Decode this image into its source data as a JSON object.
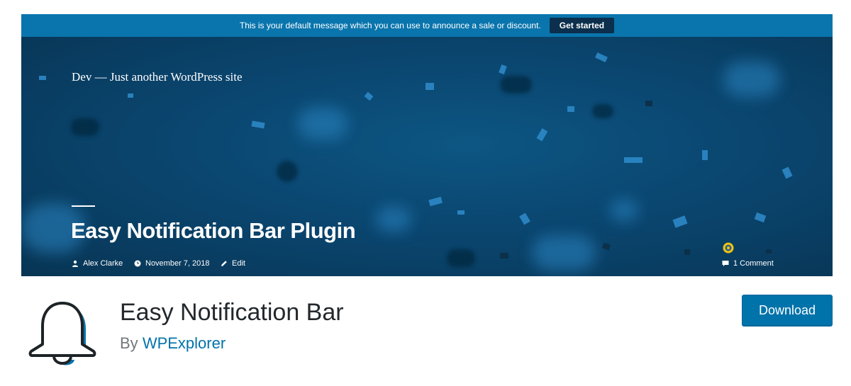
{
  "notification_bar": {
    "message": "This is your default message which you can use to announce a sale or discount.",
    "button_label": "Get started"
  },
  "hero": {
    "site_title": "Dev — Just another WordPress site",
    "post_title": "Easy Notification Bar Plugin",
    "author": "Alex Clarke",
    "date": "November 7, 2018",
    "edit_label": "Edit",
    "comments": "1 Comment"
  },
  "plugin": {
    "name": "Easy Notification Bar",
    "by_prefix": "By",
    "author": "WPExplorer",
    "download_label": "Download"
  },
  "colors": {
    "notice_bar": "#0a75ad",
    "hero_background": "#0a4670",
    "link": "#0073aa",
    "download_button": "#0073aa"
  },
  "icons": [
    "user-icon",
    "clock-icon",
    "pencil-icon",
    "comment-icon",
    "bell-icon"
  ]
}
